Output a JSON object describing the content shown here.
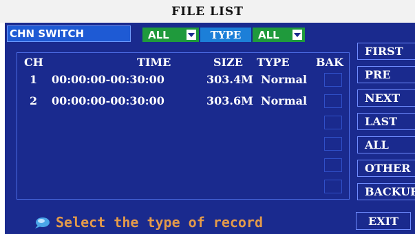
{
  "window": {
    "title": "FILE LIST"
  },
  "filter": {
    "chn_switch_label": "CHN SWITCH",
    "channel_value": "ALL",
    "type_label": "TYPE",
    "type_value": "ALL"
  },
  "table": {
    "headers": {
      "ch": "CH",
      "time": "TIME",
      "size": "SIZE",
      "type": "TYPE",
      "bak": "BAK"
    },
    "rows": [
      {
        "ch": "1",
        "time": "00:00:00-00:30:00",
        "size": "303.4M",
        "type": "Normal"
      },
      {
        "ch": "2",
        "time": "00:00:00-00:30:00",
        "size": "303.6M",
        "type": "Normal"
      }
    ]
  },
  "side_buttons": {
    "first": "FIRST",
    "pre": "PRE",
    "next": "NEXT",
    "last": "LAST",
    "all": "ALL",
    "other": "OTHER",
    "backup": "BACKUP"
  },
  "status": {
    "message": "Select the type of record",
    "icon": "info-bubble-icon"
  },
  "exit_label": "EXIT",
  "colors": {
    "panel": "#1a2a8e",
    "status_text": "#e39a4a",
    "select_green": "#1f9a3c",
    "type_blue": "#1c7fd8",
    "chn_blue": "#1e5ad4"
  }
}
